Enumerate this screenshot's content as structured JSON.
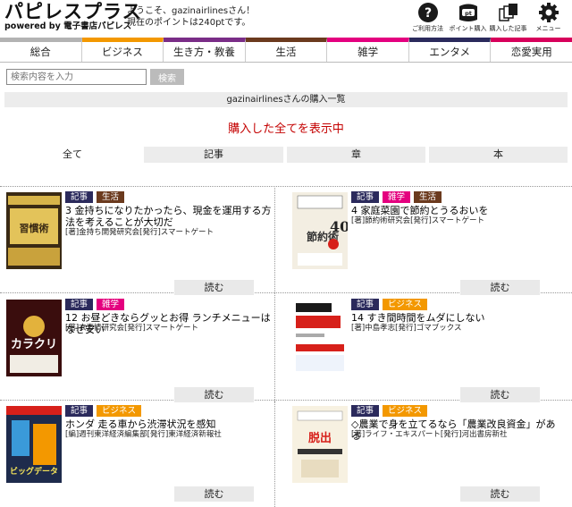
{
  "header": {
    "logo_title": "パピレスプラス",
    "logo_sub": "powered by 電子書店パピレス",
    "welcome_line1": "ようこそ、gazinairlinesさん！",
    "welcome_line2": "現在のポイントは240ptです。",
    "icons": [
      {
        "name": "help",
        "label": "ご利用方法"
      },
      {
        "name": "points",
        "label": "ポイント購入"
      },
      {
        "name": "purchased",
        "label": "購入した記事"
      },
      {
        "name": "menu",
        "label": "メニュー"
      }
    ]
  },
  "categories": [
    {
      "label": "総合",
      "color": "#b3b3b3"
    },
    {
      "label": "ビジネス",
      "color": "#f39800"
    },
    {
      "label": "生き方・教養",
      "color": "#7a2d87"
    },
    {
      "label": "生活",
      "color": "#6b3a1e"
    },
    {
      "label": "雑学",
      "color": "#e4007f"
    },
    {
      "label": "エンタメ",
      "color": "#2b2a5c"
    },
    {
      "label": "恋愛実用",
      "color": "#d7005b"
    }
  ],
  "search": {
    "placeholder": "検索内容を入力",
    "button": "検索"
  },
  "list_bar": "gazinairlinesさんの購入一覧",
  "page_title": "購入した全てを表示中",
  "filters": [
    "全て",
    "記事",
    "章",
    "本"
  ],
  "tag_colors": {
    "記事": "#2b2a5c",
    "生活": "#6b3a1e",
    "雑学": "#e4007f",
    "ビジネス": "#f39800"
  },
  "items": [
    {
      "tags": [
        "記事",
        "生活"
      ],
      "title": "3  金持ちになりたかったら、現金を運用する方法を考えることが大切だ",
      "meta": "[著]金持ち開発研究会[発行]スマートゲート",
      "button": "読む",
      "cover_text": "お金持ち習慣術"
    },
    {
      "tags": [
        "記事",
        "雑学",
        "生活"
      ],
      "title": "4  家庭菜園で節約とうるおいを",
      "meta": "[著]節約術研究会[発行]スマートゲート",
      "button": "読む",
      "cover_text": "節約術"
    },
    {
      "tags": [
        "記事",
        "雑学"
      ],
      "title": "12  お昼どきならグッとお得  ランチメニューはなぜ安い",
      "meta": "[著]衣事情研究会[発行]スマートゲート",
      "button": "読む",
      "cover_text": "カラクリ"
    },
    {
      "tags": [
        "記事",
        "ビジネス"
      ],
      "title": "14  すき間時間をムダにしない",
      "meta": "[著]中島孝志[発行]ゴマブックス",
      "button": "読む",
      "cover_text": "さっさとやれば、なんでもできる!"
    },
    {
      "tags": [
        "記事",
        "ビジネス"
      ],
      "title": "ホンダ  走る車から渋滞状況を感知",
      "meta": "[編]週刊東洋経済編集部[発行]東洋経済新報社",
      "button": "読む",
      "cover_text": "ビッグデータ"
    },
    {
      "tags": [
        "記事",
        "ビジネス"
      ],
      "title": "◇農業で身を立てるなら「農業改良資金」がある",
      "meta": "[著]ライフ・エキスパート[発行]河出書房新社",
      "button": "読む",
      "cover_text": "脱出マニュアル"
    }
  ]
}
